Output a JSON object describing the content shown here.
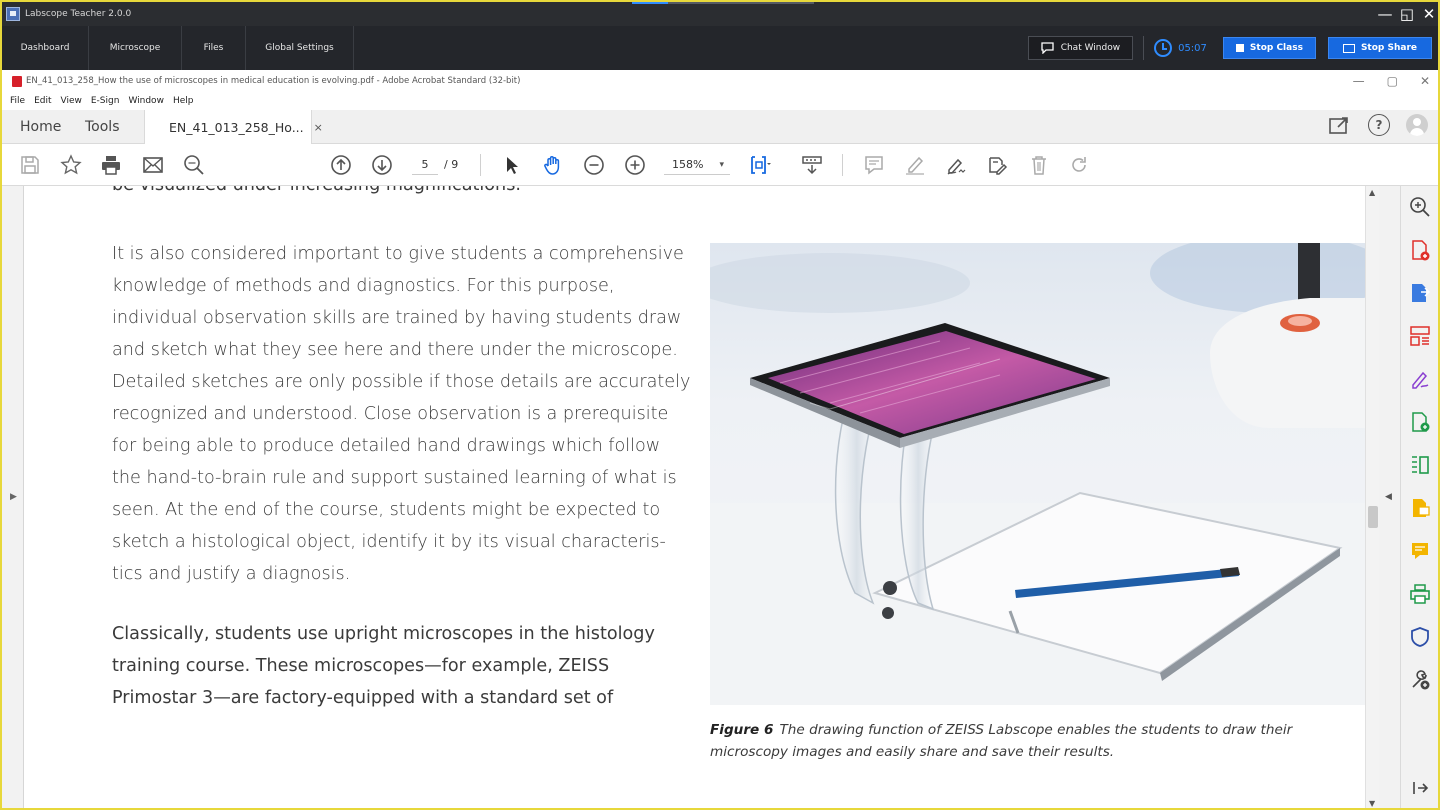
{
  "labscope": {
    "window_title": "Labscope Teacher 2.0.0",
    "nav": [
      "Dashboard",
      "Microscope",
      "Files",
      "Global Settings"
    ],
    "chat_label": "Chat Window",
    "timer": "05:07",
    "stop_class_label": "Stop Class",
    "stop_share_label": "Stop Share",
    "window_controls": [
      "—",
      "◱",
      "✕"
    ]
  },
  "acrobat": {
    "window_title": "EN_41_013_258_How the use of microscopes in medical education is evolving.pdf - Adobe Acrobat Standard (32-bit)",
    "window_controls": [
      "—",
      "▢",
      "✕"
    ],
    "menu": [
      "File",
      "Edit",
      "View",
      "E-Sign",
      "Window",
      "Help"
    ],
    "tabs": {
      "home": "Home",
      "tools": "Tools",
      "document": "EN_41_013_258_Ho...",
      "close": "×"
    },
    "help_icon": "?",
    "page_current": "5",
    "page_total": "/ 9",
    "zoom": "158%"
  },
  "document": {
    "cut_line": "be visualized under increasing magnifications.",
    "paragraph_1": "It is also considered important to give students a comprehensive knowledge of methods and diagnostics. For this purpose, individual observation skills are trained by having students draw and sketch what they see here and there under the microscope. Detailed sketches are only possible if those details are accurately recognized and understood. Close observation is a prerequisite for being able to produce detailed hand drawings which follow the hand-to-brain rule and support sustained learning of what is seen. At the end of the course, students might be expected to sketch a histological object, identify it by its visual characteris-tics and justify a diagnosis.",
    "paragraph_2": "Classically, students use upright microscopes in the histology training course. These microscopes—for example, ZEISS Primostar 3—are factory-equipped with a standard set of",
    "figure_label": "Figure 6",
    "figure_caption": "The drawing function of ZEISS Labscope enables the students to draw their microscopy images and easily share and save their results."
  },
  "colors": {
    "accent": "#1769e0",
    "frame": "#e7d83b",
    "pdf_red": "#d6202a"
  }
}
